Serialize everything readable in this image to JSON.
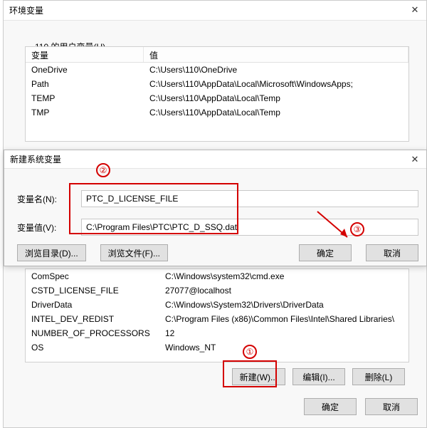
{
  "window1": {
    "title": "环境变量",
    "user_vars_label": "110 的用户变量(U)",
    "table_headers": {
      "var": "变量",
      "val": "值"
    },
    "user_vars": [
      {
        "name": "OneDrive",
        "value": "C:\\Users\\110\\OneDrive"
      },
      {
        "name": "Path",
        "value": "C:\\Users\\110\\AppData\\Local\\Microsoft\\WindowsApps;"
      },
      {
        "name": "TEMP",
        "value": "C:\\Users\\110\\AppData\\Local\\Temp"
      },
      {
        "name": "TMP",
        "value": "C:\\Users\\110\\AppData\\Local\\Temp"
      }
    ],
    "system_vars": [
      {
        "name": "ComSpec",
        "value": "C:\\Windows\\system32\\cmd.exe"
      },
      {
        "name": "CSTD_LICENSE_FILE",
        "value": "27077@localhost"
      },
      {
        "name": "DriverData",
        "value": "C:\\Windows\\System32\\Drivers\\DriverData"
      },
      {
        "name": "INTEL_DEV_REDIST",
        "value": "C:\\Program Files (x86)\\Common Files\\Intel\\Shared Libraries\\"
      },
      {
        "name": "NUMBER_OF_PROCESSORS",
        "value": "12"
      },
      {
        "name": "OS",
        "value": "Windows_NT"
      }
    ],
    "sys_buttons": {
      "new": "新建(W)...",
      "edit": "编辑(I)...",
      "delete": "删除(L)"
    },
    "bottom_buttons": {
      "ok": "确定",
      "cancel": "取消"
    }
  },
  "window2": {
    "title": "新建系统变量",
    "labels": {
      "name": "变量名(N):",
      "value": "变量值(V):"
    },
    "values": {
      "name": "PTC_D_LICENSE_FILE",
      "value": "C:\\Program Files\\PTC\\PTC_D_SSQ.dat"
    },
    "buttons": {
      "browse_dir": "浏览目录(D)...",
      "browse_file": "浏览文件(F)...",
      "ok": "确定",
      "cancel": "取消"
    }
  },
  "annotations": {
    "n1": "①",
    "n2": "②",
    "n3": "③"
  }
}
